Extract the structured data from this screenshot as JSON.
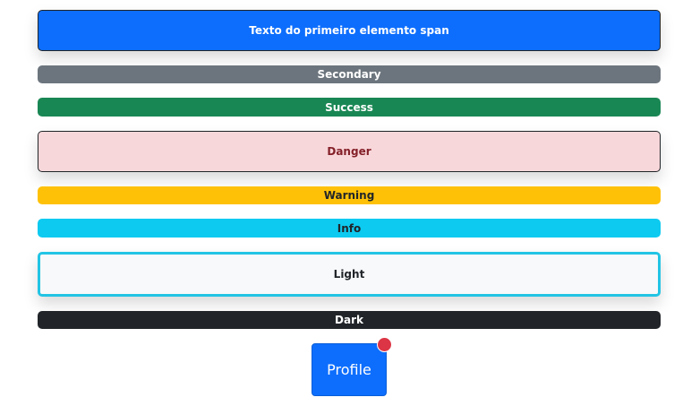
{
  "badges": {
    "primary": {
      "label": "Texto do primeiro elemento span",
      "color": "#0d6efd"
    },
    "secondary": {
      "label": "Secondary",
      "color": "#6c757d"
    },
    "success": {
      "label": "Success",
      "color": "#198754"
    },
    "danger": {
      "label": "Danger",
      "color": "#f8d7da",
      "text_color": "#842029"
    },
    "warning": {
      "label": "Warning",
      "color": "#ffc107"
    },
    "info": {
      "label": "Info",
      "color": "#0dcaf0"
    },
    "light": {
      "label": "Light",
      "color": "#f8f9fa",
      "border_color": "#22c4e4"
    },
    "dark": {
      "label": "Dark",
      "color": "#212529"
    }
  },
  "profile": {
    "button_label": "Profile",
    "button_color": "#0d6efd",
    "notification_dot_color": "#dc3545"
  }
}
